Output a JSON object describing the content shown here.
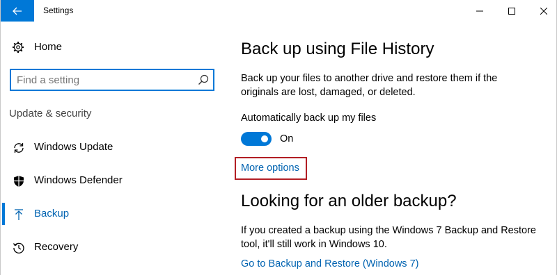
{
  "window": {
    "title": "Settings",
    "accent_color": "#0078d7",
    "controls": [
      "minimize-icon",
      "maximize-icon",
      "close-icon"
    ]
  },
  "sidebar": {
    "home_label": "Home",
    "search_placeholder": "Find a setting",
    "section_label": "Update & security",
    "items": [
      {
        "label": "Windows Update",
        "icon": "refresh-icon",
        "active": false
      },
      {
        "label": "Windows Defender",
        "icon": "shield-icon",
        "active": false
      },
      {
        "label": "Backup",
        "icon": "upload-arrow-icon",
        "active": true
      },
      {
        "label": "Recovery",
        "icon": "history-icon",
        "active": false
      }
    ]
  },
  "main": {
    "title": "Back up using File History",
    "description": "Back up your files to another drive and restore them if the originals are lost, damaged, or deleted.",
    "auto_backup_label": "Automatically back up my files",
    "toggle_state": "On",
    "toggle_on": true,
    "more_options_link": "More options",
    "highlight_color": "#b21e24",
    "older_backup_title": "Looking for an older backup?",
    "older_backup_description": "If you created a backup using the Windows 7 Backup and Restore tool, it'll still work in Windows 10.",
    "restore_link": "Go to Backup and Restore (Windows 7)",
    "link_color": "#0063b1"
  }
}
